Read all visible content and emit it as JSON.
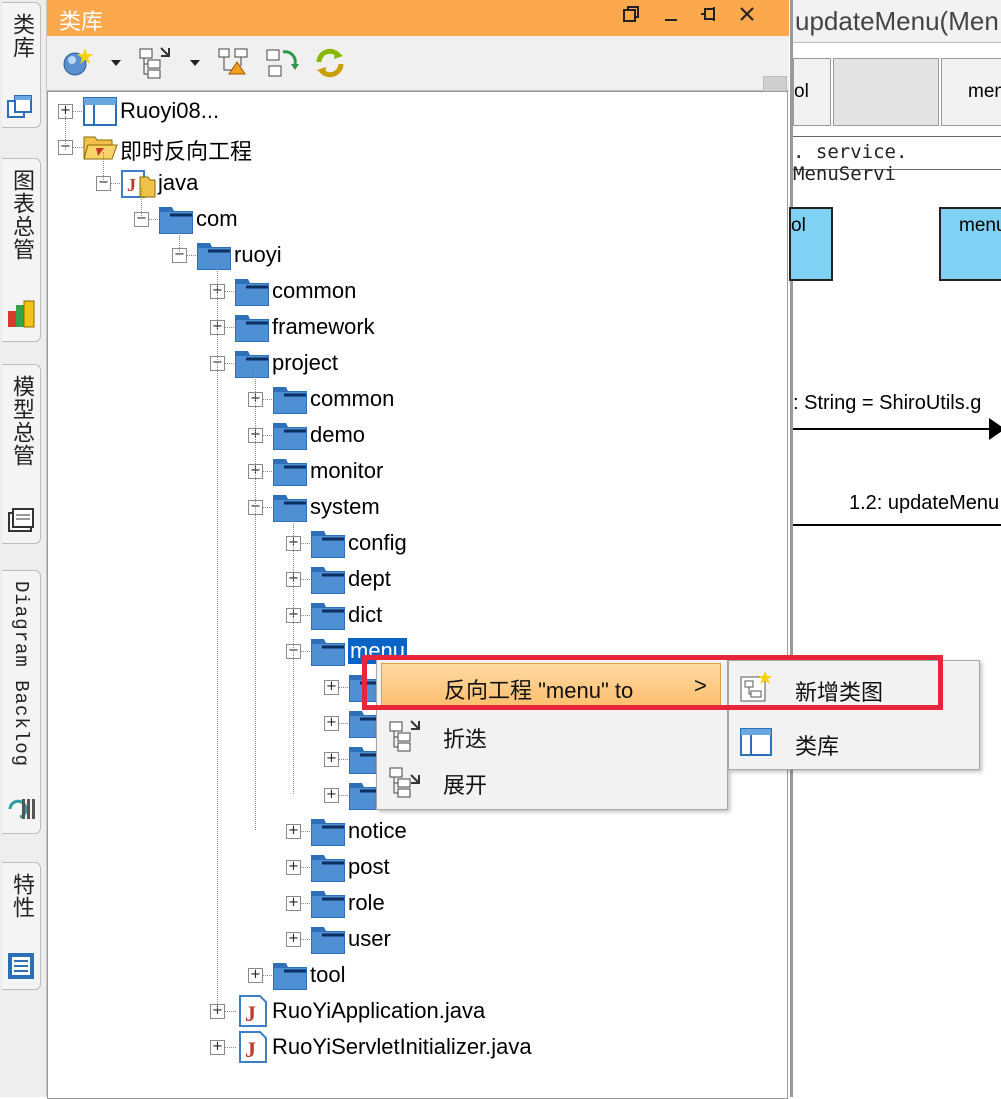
{
  "sidebar": {
    "tabs": [
      {
        "label": "类库",
        "icon": "library-icon"
      },
      {
        "label": "图表总管",
        "icon": "diagram-navigator-icon"
      },
      {
        "label": "模型总管",
        "icon": "model-navigator-icon"
      },
      {
        "label": "Diagram Backlog",
        "icon": "backlog-icon"
      },
      {
        "label": "特性",
        "icon": "properties-icon"
      }
    ]
  },
  "panel": {
    "title": "类库",
    "title_bar_color": "#fca84d"
  },
  "tree": {
    "selection_color": "#0a64c8",
    "nodes": [
      {
        "label": "Ruoyi08..."
      },
      {
        "label": "即时反向工程"
      },
      {
        "label": "java"
      },
      {
        "label": "com"
      },
      {
        "label": "ruoyi"
      },
      {
        "label": "common"
      },
      {
        "label": "framework"
      },
      {
        "label": "project"
      },
      {
        "label": "common"
      },
      {
        "label": "demo"
      },
      {
        "label": "monitor"
      },
      {
        "label": "system"
      },
      {
        "label": "config"
      },
      {
        "label": "dept"
      },
      {
        "label": "dict"
      },
      {
        "label": "menu"
      },
      {
        "label": "notice"
      },
      {
        "label": "post"
      },
      {
        "label": "role"
      },
      {
        "label": "user"
      },
      {
        "label": "tool"
      },
      {
        "label": "RuoYiApplication.java"
      },
      {
        "label": "RuoYiServletInitializer.java"
      }
    ]
  },
  "context_menu": {
    "items": [
      {
        "label": "反向工程 \"menu\" to",
        "arrow": ">"
      },
      {
        "label": "折迭"
      },
      {
        "label": "展开"
      }
    ]
  },
  "submenu": {
    "items": [
      {
        "label": "新增类图"
      },
      {
        "label": "类库"
      }
    ],
    "highlight_color": "#e8253a"
  },
  "diagram": {
    "tab_title": "updateMenu(Men",
    "header_cells": [
      "ol",
      "men"
    ],
    "service_text": ". service. MenuServi",
    "boxes": [
      "ol",
      "menu"
    ],
    "message1": ": String = ShiroUtils.g",
    "message2": "1.2: updateMenu",
    "box_color": "#7fd2f4"
  }
}
